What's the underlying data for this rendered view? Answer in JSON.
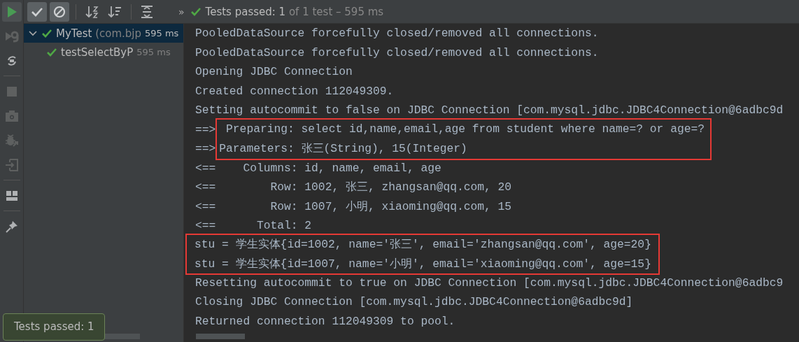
{
  "side_toolbar": [
    {
      "kind": "run",
      "disabled": false
    },
    {
      "kind": "rerun-failed",
      "disabled": true
    },
    {
      "kind": "toggle-auto",
      "disabled": false
    },
    {
      "kind": "stop",
      "disabled": true
    },
    {
      "kind": "camera",
      "disabled": true
    },
    {
      "kind": "bug-export",
      "disabled": true
    },
    {
      "kind": "import",
      "disabled": true
    },
    {
      "kind": "layout",
      "disabled": false
    },
    {
      "kind": "pin",
      "disabled": false
    }
  ],
  "toolbar": {
    "toggles": [
      {
        "kind": "passed",
        "selected": true
      },
      {
        "kind": "ignored",
        "selected": true
      }
    ],
    "actions": [
      {
        "kind": "sort-alpha"
      },
      {
        "kind": "sort-duration"
      },
      {
        "kind": "expand-collapse"
      }
    ],
    "more": "»",
    "status": {
      "label": "Tests passed: 1",
      "detail": " of 1 test – 595 ms"
    }
  },
  "tree": [
    {
      "name": "MyTest",
      "detail": "(com.bjp",
      "time": "595 ms",
      "passed": true,
      "selected": true,
      "expanded": true,
      "children": [
        {
          "name": "testSelectByP",
          "time": "595 ms",
          "passed": true,
          "selected": false
        }
      ]
    }
  ],
  "console": {
    "lines": [
      {
        "text": "PooledDataSource forcefully closed/removed all connections.",
        "marked": false
      },
      {
        "text": "PooledDataSource forcefully closed/removed all connections.",
        "marked": false
      },
      {
        "text": "Opening JDBC Connection",
        "marked": false
      },
      {
        "text": "Created connection 112049309.",
        "marked": false
      },
      {
        "text": "Setting autocommit to false on JDBC Connection [com.mysql.jdbc.JDBC4Connection@6adbc9d",
        "marked": false
      },
      {
        "prefix": "==>",
        "text": " Preparing: select id,name,email,age from student where name=? or age=?",
        "marked": true
      },
      {
        "prefix": "==>",
        "text": "Parameters: 张三(String), 15(Integer)",
        "marked": true
      },
      {
        "text": "<==    Columns: id, name, email, age",
        "marked": false
      },
      {
        "text": "<==        Row: 1002, 张三, zhangsan@qq.com, 20",
        "marked": false
      },
      {
        "text": "<==        Row: 1007, 小明, xiaoming@qq.com, 15",
        "marked": false
      },
      {
        "text": "<==      Total: 2",
        "marked": false
      },
      {
        "text": "stu = 学生实体{id=1002, name='张三', email='zhangsan@qq.com', age=20}",
        "marked": true
      },
      {
        "text": "stu = 学生实体{id=1007, name='小明', email='xiaoming@qq.com', age=15}",
        "marked": true
      },
      {
        "text": "Resetting autocommit to true on JDBC Connection [com.mysql.jdbc.JDBC4Connection@6adbc9",
        "marked": false
      },
      {
        "text": "Closing JDBC Connection [com.mysql.jdbc.JDBC4Connection@6adbc9d]",
        "marked": false
      },
      {
        "text": "Returned connection 112049309 to pool.",
        "marked": false
      }
    ]
  },
  "toast": {
    "text": "Tests passed: 1"
  }
}
